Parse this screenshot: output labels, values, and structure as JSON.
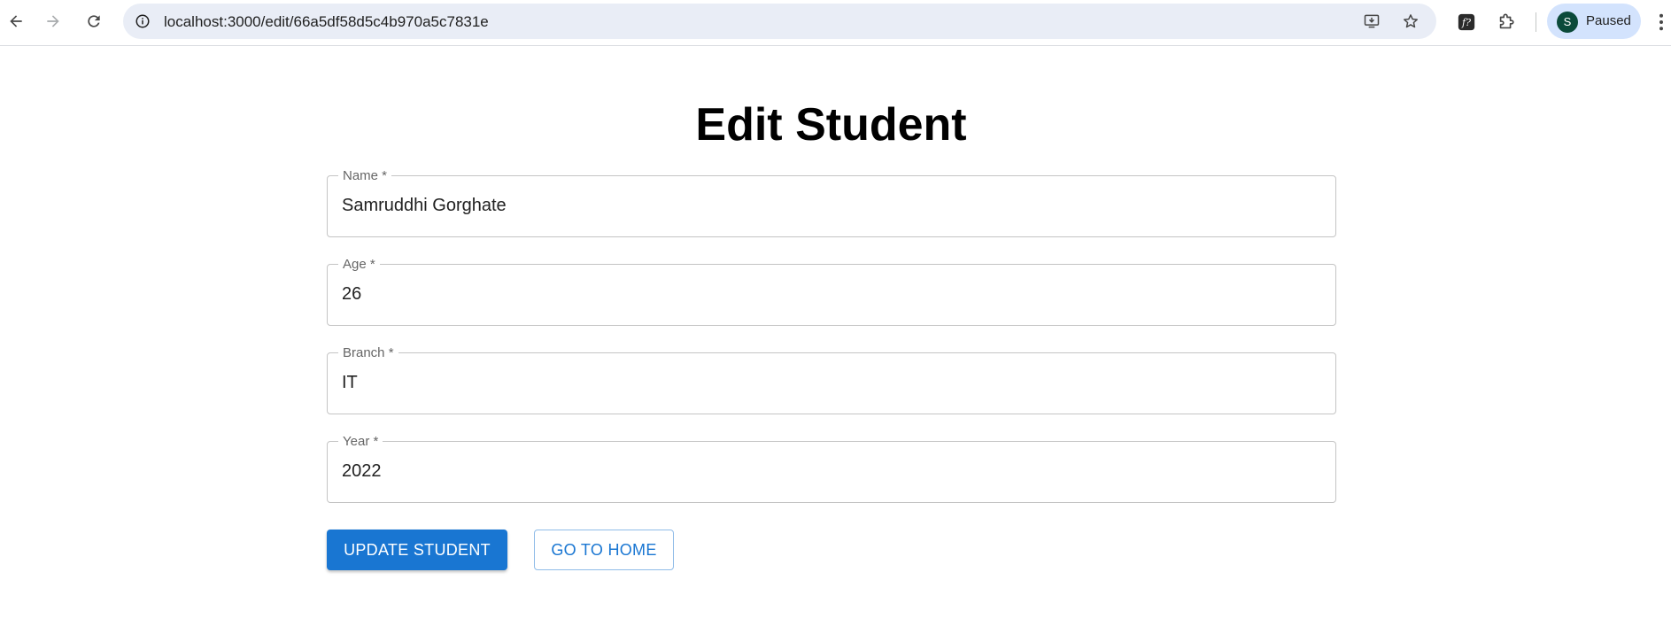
{
  "browser": {
    "url": "localhost:3000/edit/66a5df58d5c4b970a5c7831e",
    "profile_initial": "S",
    "profile_status": "Paused"
  },
  "page": {
    "title": "Edit Student"
  },
  "form": {
    "fields": [
      {
        "label": "Name *",
        "value": "Samruddhi Gorghate"
      },
      {
        "label": "Age *",
        "value": "26"
      },
      {
        "label": "Branch *",
        "value": "IT"
      },
      {
        "label": "Year *",
        "value": "2022"
      }
    ],
    "update_label": "UPDATE STUDENT",
    "home_label": "GO TO HOME"
  },
  "colors": {
    "primary": "#1976d2",
    "omnibox_bg": "#e9edf6",
    "profile_chip_bg": "#d3e3fd"
  }
}
